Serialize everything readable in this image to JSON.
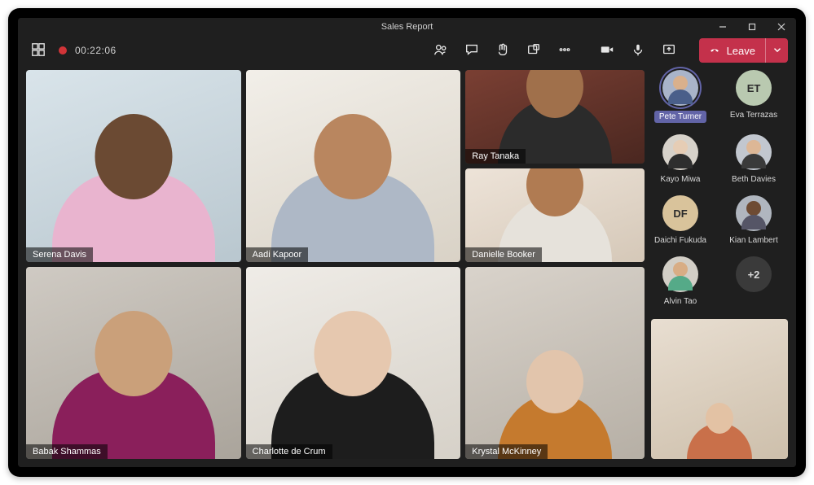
{
  "titlebar": {
    "title": "Sales Report"
  },
  "toolbar": {
    "timer": "00:22:06",
    "leave_label": "Leave"
  },
  "participants_grid": [
    {
      "name": "Serena Davis",
      "bg1": "#d9e4ea",
      "bg2": "#b9c7cf",
      "skin": "#6b4a33",
      "shirt": "#e9b4cf"
    },
    {
      "name": "Aadi Kapoor",
      "bg1": "#f2efe9",
      "bg2": "#d9d2c6",
      "skin": "#b9865f",
      "shirt": "#aeb8c6"
    },
    {
      "name": "Ray Tanaka",
      "bg1": "#7a3f33",
      "bg2": "#4a2720",
      "skin": "#a0704b",
      "shirt": "#2b2b2b"
    },
    {
      "name": "Danielle Booker",
      "bg1": "#ede3d8",
      "bg2": "#d5c8b8",
      "skin": "#b07b52",
      "shirt": "#e6e2db"
    },
    {
      "name": "Babak Shammas",
      "bg1": "#cfcac3",
      "bg2": "#aaa49b",
      "skin": "#caa07a",
      "shirt": "#8a1f5b"
    },
    {
      "name": "Charlotte de Crum",
      "bg1": "#efece7",
      "bg2": "#d6d1c8",
      "skin": "#e6c8af",
      "shirt": "#1d1d1d"
    },
    {
      "name": "Krystal McKinney",
      "bg1": "#d9d3cb",
      "bg2": "#b6afa5",
      "skin": "#e2c5ac",
      "shirt": "#c57a2e"
    }
  ],
  "roster": [
    {
      "name": "Pete Turner",
      "type": "image",
      "highlight": true,
      "skin": "#d9b08c",
      "shirt": "#4a5f8a",
      "av_bg": "#a9b4c9"
    },
    {
      "name": "Eva Terrazas",
      "type": "initials",
      "initials": "ET",
      "bg": "#b9c9b0"
    },
    {
      "name": "Kayo Miwa",
      "type": "image",
      "skin": "#e6cdb5",
      "shirt": "#2e2e2e",
      "av_bg": "#d7d2ca"
    },
    {
      "name": "Beth Davies",
      "type": "image",
      "skin": "#ddb796",
      "shirt": "#3a3a3a",
      "av_bg": "#c2c7cf"
    },
    {
      "name": "Daichi Fukuda",
      "type": "initials",
      "initials": "DF",
      "bg": "#d9c39b"
    },
    {
      "name": "Kian Lambert",
      "type": "image",
      "skin": "#6e4b33",
      "shirt": "#556",
      "av_bg": "#b0b6bf"
    },
    {
      "name": "Alvin Tao",
      "type": "image",
      "skin": "#d8ad85",
      "shirt": "#5a8",
      "av_bg": "#d2cec6"
    },
    {
      "name": "+2",
      "type": "plus"
    }
  ],
  "self_preview": {
    "bg1": "#e8ded1",
    "bg2": "#cdbfab",
    "skin": "#e3c2a4",
    "shirt": "#c9704a"
  }
}
